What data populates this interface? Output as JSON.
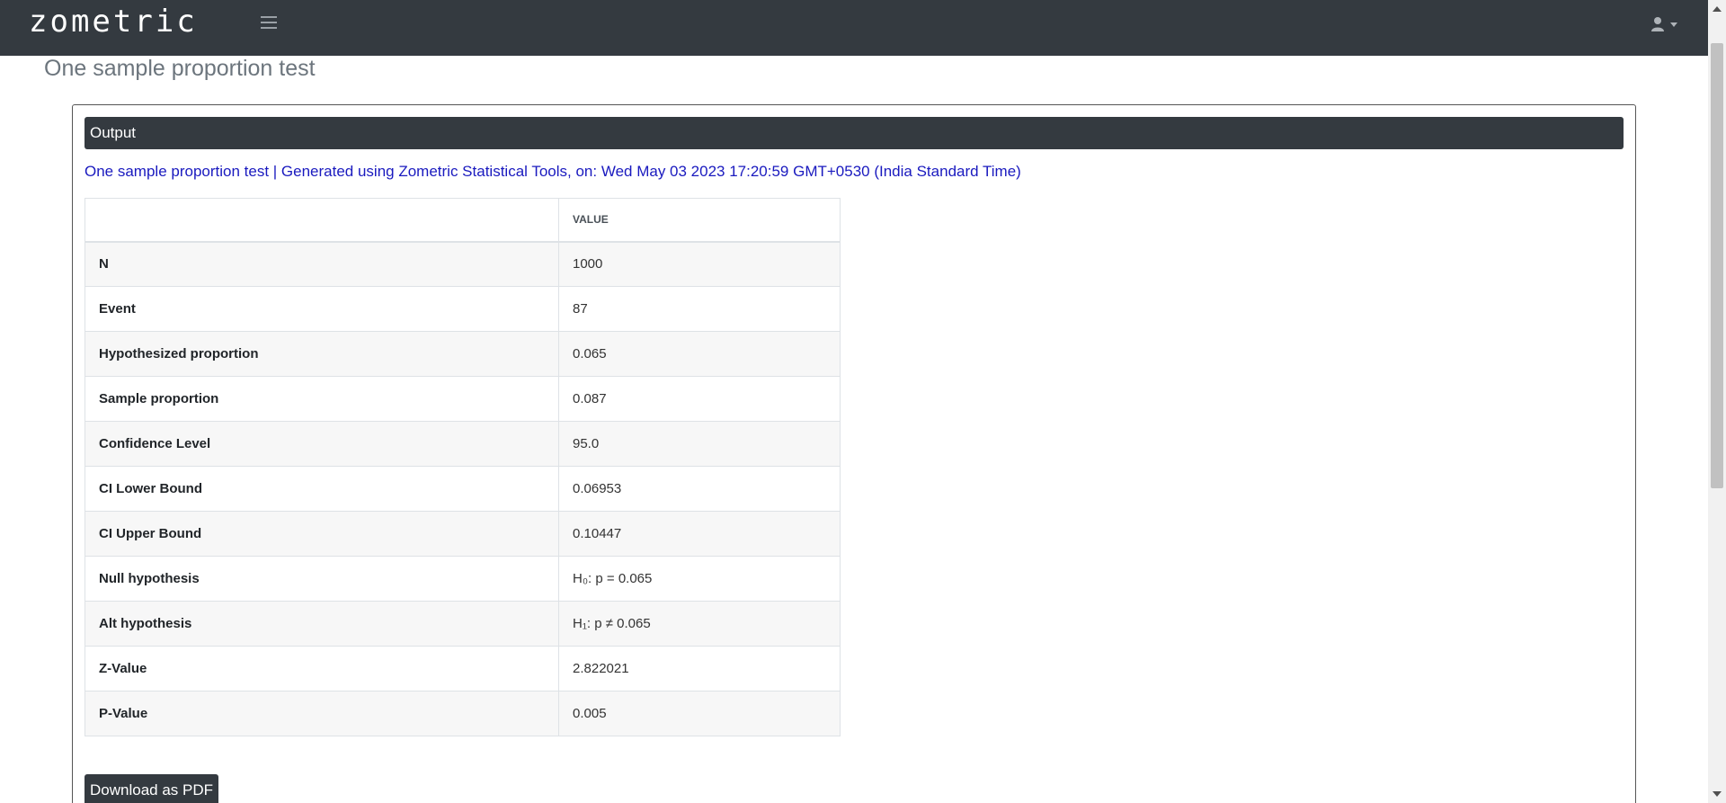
{
  "navbar": {
    "logo_text": "zometric",
    "menu_icon": "hamburger-menu-icon",
    "user_icon": "user-icon",
    "user_caret_icon": "caret-down-icon"
  },
  "page": {
    "title": "One sample proportion test"
  },
  "output": {
    "header": "Output",
    "report_line": "One sample proportion test | Generated using Zometric Statistical Tools, on: Wed May 03 2023 17:20:59 GMT+0530 (India Standard Time)",
    "table": {
      "columns": [
        "",
        "VALUE"
      ],
      "rows": [
        {
          "label": "N",
          "value": "1000"
        },
        {
          "label": "Event",
          "value": "87"
        },
        {
          "label": "Hypothesized proportion",
          "value": "0.065"
        },
        {
          "label": "Sample proportion",
          "value": "0.087"
        },
        {
          "label": "Confidence Level",
          "value": "95.0"
        },
        {
          "label": "CI Lower Bound",
          "value": "0.06953"
        },
        {
          "label": "CI Upper Bound",
          "value": "0.10447"
        },
        {
          "label": "Null hypothesis",
          "value": "H₀: p = 0.065"
        },
        {
          "label": "Alt hypothesis",
          "value": "H₁: p ≠ 0.065"
        },
        {
          "label": "Z-Value",
          "value": "2.822021"
        },
        {
          "label": "P-Value",
          "value": "0.005"
        }
      ]
    },
    "download_label": "Download as PDF"
  },
  "colors": {
    "navbar_bg": "#343a40",
    "report_text": "#1a1abf",
    "stripe": "#f7f7f7"
  }
}
